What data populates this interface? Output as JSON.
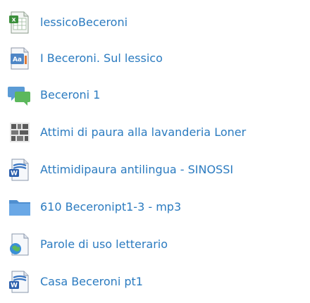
{
  "items": [
    {
      "label": "lessicoBeceroni",
      "icon": "spreadsheet-icon"
    },
    {
      "label": "I Beceroni. Sul lessico",
      "icon": "presentation-icon"
    },
    {
      "label": "Beceroni 1",
      "icon": "discussion-forum-icon"
    },
    {
      "label": "Attimi di paura alla lavanderia Loner",
      "icon": "interactive-activity-icon"
    },
    {
      "label": "Attimidipaura antilingua - SINOSSI",
      "icon": "word-document-icon"
    },
    {
      "label": "610 Beceronipt1-3 - mp3",
      "icon": "folder-icon"
    },
    {
      "label": "Parole di uso letterario",
      "icon": "web-link-icon"
    },
    {
      "label": "Casa Beceroni pt1",
      "icon": "word-document-icon"
    }
  ],
  "colors": {
    "link": "#2b7bc0",
    "folder": "#5b9bd5",
    "forum": "#4caf50"
  }
}
